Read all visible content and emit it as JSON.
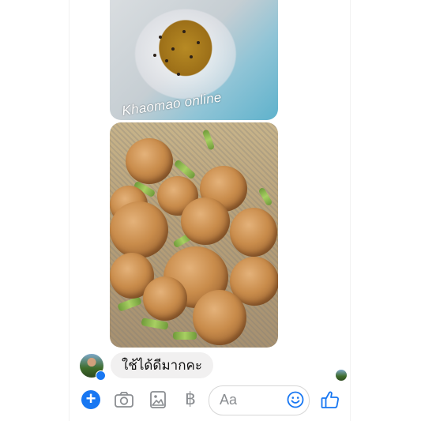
{
  "watermark": "Khaomao online",
  "message": {
    "text": "ใช้ได้ดีมากคะ"
  },
  "composer": {
    "placeholder": "Aa",
    "currency_symbol": "฿"
  },
  "colors": {
    "accent": "#1877f2",
    "bubble": "#f1f0f0"
  },
  "icons": [
    "plus-icon",
    "camera-icon",
    "image-icon",
    "baht-icon",
    "emoji-icon",
    "thumbs-up-icon"
  ]
}
